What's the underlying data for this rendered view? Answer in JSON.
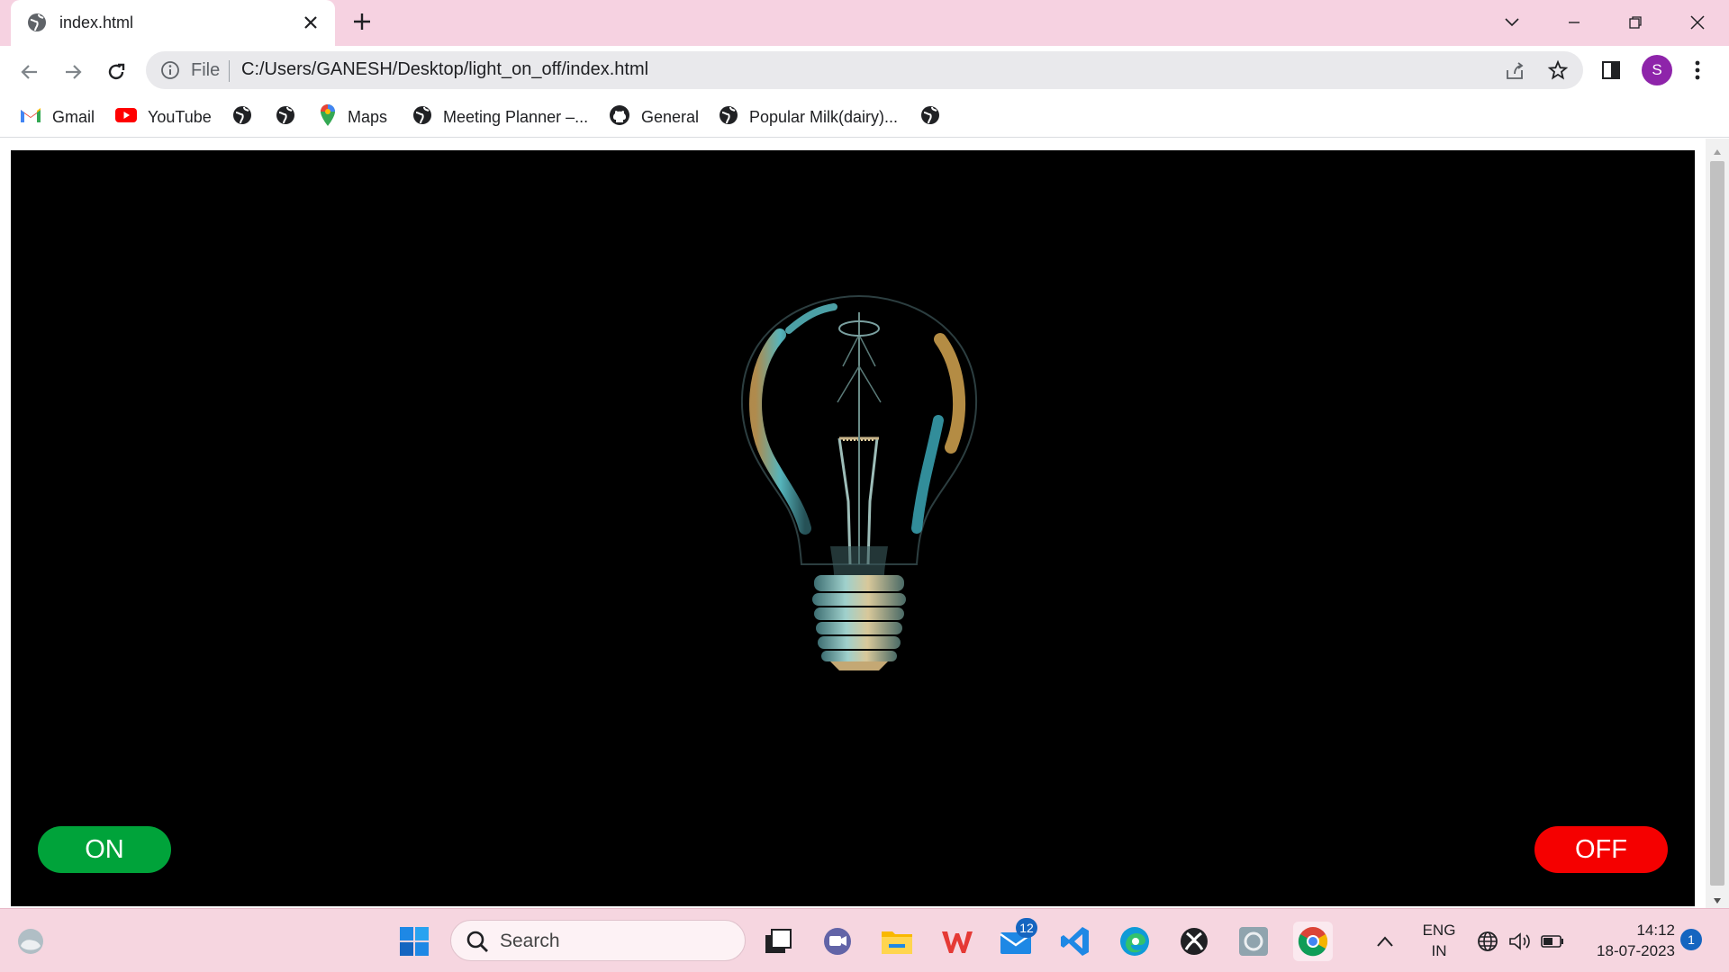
{
  "tab": {
    "title": "index.html"
  },
  "toolbar": {
    "scheme": "File",
    "url": "C:/Users/GANESH/Desktop/light_on_off/index.html",
    "profile_initial": "S"
  },
  "bookmarks": [
    {
      "label": "Gmail",
      "icon": "gmail-icon"
    },
    {
      "label": "YouTube",
      "icon": "youtube-icon"
    },
    {
      "label": "",
      "icon": "globe-icon"
    },
    {
      "label": "",
      "icon": "globe-icon"
    },
    {
      "label": "Maps",
      "icon": "maps-icon"
    },
    {
      "label": "Meeting Planner –...",
      "icon": "globe-icon"
    },
    {
      "label": "General",
      "icon": "github-icon"
    },
    {
      "label": "Popular Milk(dairy)...",
      "icon": "globe-icon"
    },
    {
      "label": "",
      "icon": "globe-icon"
    }
  ],
  "page": {
    "on_label": "ON",
    "off_label": "OFF",
    "colors": {
      "on": "#00a33a",
      "off": "#f50000",
      "background": "#000000"
    }
  },
  "taskbar": {
    "search_placeholder": "Search",
    "mail_badge": "12",
    "lang_top": "ENG",
    "lang_bottom": "IN",
    "time": "14:12",
    "date": "18-07-2023",
    "notifications": "1"
  }
}
